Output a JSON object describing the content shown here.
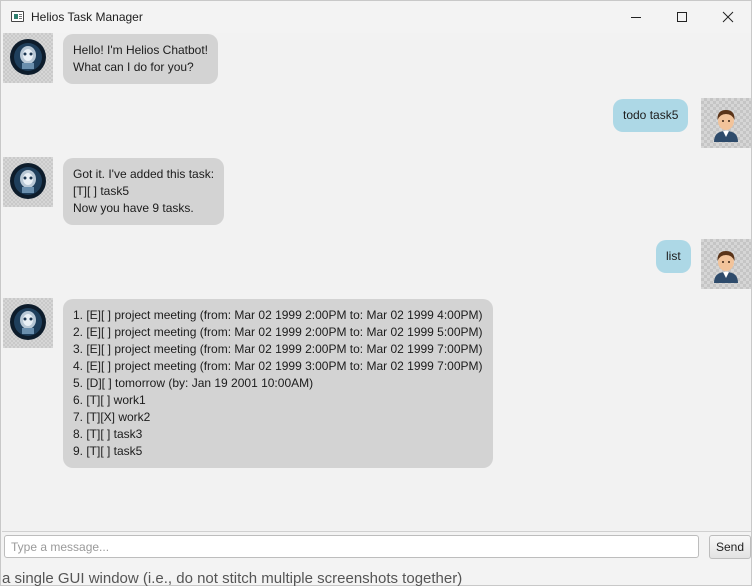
{
  "window": {
    "title": "Helios Task Manager"
  },
  "messages": [
    {
      "sender": "bot",
      "lines": [
        "Hello! I'm Helios Chatbot!",
        "What can I do for you?"
      ]
    },
    {
      "sender": "user",
      "lines": [
        "todo task5"
      ]
    },
    {
      "sender": "bot",
      "lines": [
        "Got it. I've added this task:",
        "[T][ ] task5",
        "Now you have 9 tasks."
      ]
    },
    {
      "sender": "user",
      "lines": [
        "list"
      ]
    },
    {
      "sender": "bot",
      "lines": [
        "1. [E][ ] project meeting (from: Mar 02 1999 2:00PM to: Mar 02 1999 4:00PM)",
        "2. [E][ ] project meeting (from: Mar 02 1999 2:00PM to: Mar 02 1999 5:00PM)",
        "3. [E][ ] project meeting (from: Mar 02 1999 2:00PM to: Mar 02 1999 7:00PM)",
        "4. [E][ ] project meeting (from: Mar 02 1999 3:00PM to: Mar 02 1999 7:00PM)",
        "5. [D][ ] tomorrow (by: Jan 19 2001 10:00AM)",
        "6. [T][ ] work1",
        "7. [T][X] work2",
        "8. [T][ ] task3",
        "9. [T][ ] task5"
      ]
    }
  ],
  "input": {
    "placeholder": "Type a message...",
    "value": ""
  },
  "send_button": {
    "label": "Send"
  },
  "background_text": "a single GUI window (i.e., do not stitch multiple screenshots together)",
  "icons": {
    "app": "app-window-icon",
    "bot_avatar": "robot-avatar-icon",
    "user_avatar": "person-avatar-icon"
  }
}
